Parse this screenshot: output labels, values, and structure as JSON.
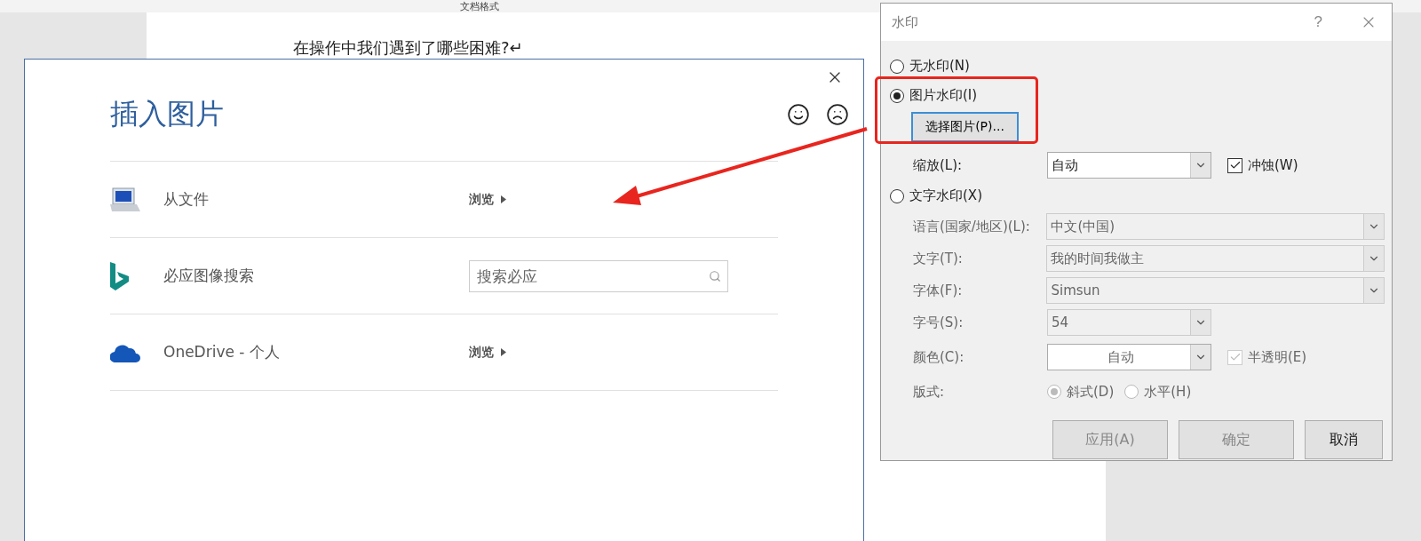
{
  "document": {
    "header_title": "文档格式",
    "lines": [
      "在操作中我们遇到了哪些困难?↵"
    ]
  },
  "insert_dialog": {
    "title": "插入图片",
    "sources": [
      {
        "kind": "browse",
        "label": "从文件",
        "action": "浏览"
      },
      {
        "kind": "search",
        "label": "必应图像搜索",
        "placeholder": "搜索必应"
      },
      {
        "kind": "browse",
        "label": "OneDrive - 个人",
        "action": "浏览"
      }
    ]
  },
  "watermark_dialog": {
    "title": "水印",
    "help": "?",
    "no_watermark": {
      "label": "无水印(N)",
      "selected": false
    },
    "picture_watermark": {
      "label": "图片水印(I)",
      "selected": true
    },
    "select_picture_button": "选择图片(P)...",
    "scale": {
      "label": "缩放(L):",
      "value": "自动"
    },
    "washout": {
      "label": "冲蚀(W)",
      "checked": true
    },
    "text_watermark": {
      "label": "文字水印(X)",
      "selected": false
    },
    "text_fields": [
      {
        "label": "语言(国家/地区)(L):",
        "value": "中文(中国)"
      },
      {
        "label": "文字(T):",
        "value": "我的时间我做主"
      },
      {
        "label": "字体(F):",
        "value": "Simsun"
      },
      {
        "label": "字号(S):",
        "value": "54"
      }
    ],
    "color": {
      "label": "颜色(C):",
      "value": "自动"
    },
    "semi_transparent": {
      "label": "半透明(E)",
      "checked": true
    },
    "layout": {
      "label": "版式:",
      "options": [
        {
          "label": "斜式(D)",
          "selected": true
        },
        {
          "label": "水平(H)",
          "selected": false
        }
      ]
    },
    "buttons": [
      {
        "label": "应用(A)",
        "disabled": true
      },
      {
        "label": "确定",
        "disabled": true
      },
      {
        "label": "取消",
        "disabled": false
      }
    ]
  }
}
